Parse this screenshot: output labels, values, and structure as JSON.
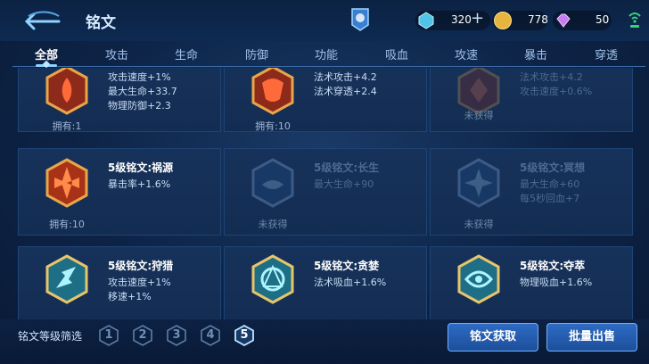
{
  "header": {
    "title": "铭文",
    "currencies": [
      {
        "name": "gem-icon",
        "value": "320",
        "color": "#4fc3e8"
      },
      {
        "name": "gold-coin-icon",
        "value": "778",
        "color": "#e8b440"
      },
      {
        "name": "crystal-icon",
        "value": "50",
        "color": "#c77cf0"
      }
    ]
  },
  "tabs": [
    {
      "label": "全部",
      "active": true
    },
    {
      "label": "攻击"
    },
    {
      "label": "生命"
    },
    {
      "label": "防御"
    },
    {
      "label": "功能"
    },
    {
      "label": "吸血"
    },
    {
      "label": "攻速"
    },
    {
      "label": "暴击"
    },
    {
      "label": "穿透"
    }
  ],
  "cards": [
    {
      "name": "",
      "stats": [
        "攻击速度+1%",
        "最大生命+33.7",
        "物理防御+2.3"
      ],
      "owned": "拥有:1",
      "color": "#c0392b"
    },
    {
      "name": "",
      "stats": [
        "法术攻击+4.2",
        "法术穿透+2.4"
      ],
      "owned": "拥有:10",
      "color": "#c0392b"
    },
    {
      "name": "",
      "stats": [
        "法术攻击+4.2",
        "攻击速度+0.6%"
      ],
      "owned": "未获得",
      "color": "#c0392b"
    },
    {
      "name": "5级铭文:祸源",
      "stats": [
        "暴击率+1.6%"
      ],
      "owned": "拥有:10",
      "color": "#d04a20"
    },
    {
      "name": "5级铭文:长生",
      "stats": [
        "最大生命+90"
      ],
      "owned": "未获得",
      "color": "#4a8fd0"
    },
    {
      "name": "5级铭文:冥想",
      "stats": [
        "最大生命+60",
        "每5秒回血+7"
      ],
      "owned": "未获得",
      "color": "#4a8fd0"
    },
    {
      "name": "5级铭文:狩猎",
      "stats": [
        "攻击速度+1%",
        "移速+1%"
      ],
      "owned": "",
      "color": "#3fb8c8"
    },
    {
      "name": "5级铭文:贪婪",
      "stats": [
        "法术吸血+1.6%"
      ],
      "owned": "",
      "color": "#3fb8c8"
    },
    {
      "name": "5级铭文:夺萃",
      "stats": [
        "物理吸血+1.6%"
      ],
      "owned": "",
      "color": "#3fb8c8"
    }
  ],
  "filter": {
    "label": "铭文等级筛选",
    "levels": [
      "1",
      "2",
      "3",
      "4",
      "5"
    ],
    "selected": "5"
  },
  "buttons": {
    "acquire": "铭文获取",
    "sell": "批量出售"
  }
}
